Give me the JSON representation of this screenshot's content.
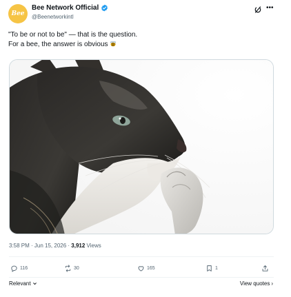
{
  "author": {
    "avatar_text": "Bee",
    "display_name": "Bee Network Official",
    "handle": "@Beenetworkintl",
    "verified": true
  },
  "post": {
    "line1": "\"To be or not to be\" — that is the question.",
    "line2": "For a bee, the answer is obvious",
    "emoji": "bee-icon",
    "media_description": "cat-photo"
  },
  "meta": {
    "time": "3:58 PM",
    "separator": " · ",
    "date": "Jun 15, 2026",
    "views_count": "3,912",
    "views_label": " Views"
  },
  "actions": {
    "replies": "116",
    "reposts": "30",
    "likes": "165",
    "bookmarks": "1"
  },
  "footer": {
    "sort_label": "Relevant",
    "view_quotes_label": "View quotes"
  },
  "colors": {
    "accent": "#1d9bf0",
    "avatar": "#f6c445",
    "text": "#0f1419",
    "muted": "#536471"
  }
}
